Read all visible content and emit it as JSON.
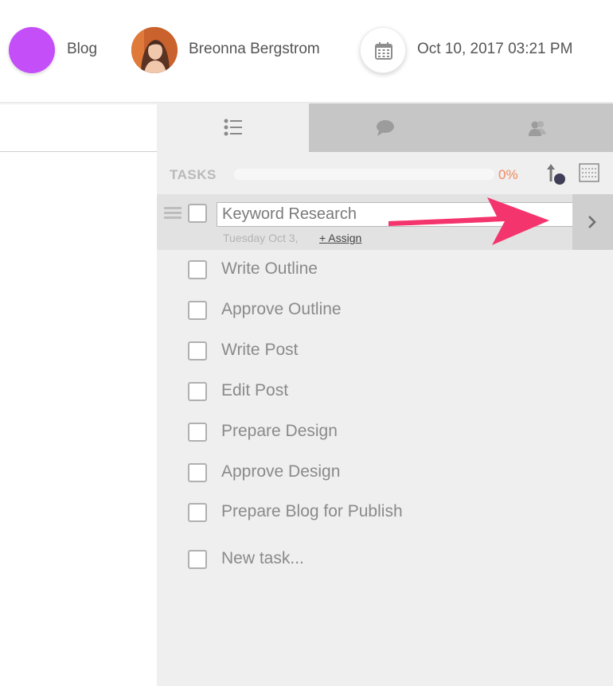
{
  "header": {
    "category_label": "Blog",
    "category_color": "#c44ef8",
    "user_name": "Breonna Bergstrom",
    "date_text": "Oct 10, 2017 03:21 PM"
  },
  "tabs": [
    {
      "name": "tasks",
      "icon": "list-icon",
      "active": true
    },
    {
      "name": "comments",
      "icon": "chat-bubble-icon",
      "active": false
    },
    {
      "name": "people",
      "icon": "people-icon",
      "active": false
    }
  ],
  "tasks_panel": {
    "heading": "TASKS",
    "progress_percent": 0,
    "progress_label": "0%",
    "accent_color": "#f08a5d",
    "selected_task": {
      "title": "Keyword Research",
      "date": "Tuesday Oct 3,",
      "assign_label": "+ Assign"
    },
    "tasks": [
      "Write Outline",
      "Approve Outline",
      "Write Post",
      "Edit Post",
      "Prepare Design",
      "Approve Design",
      "Prepare Blog for Publish"
    ],
    "new_task_placeholder": "New task..."
  },
  "annotation": {
    "arrow_color": "#f4346c"
  }
}
